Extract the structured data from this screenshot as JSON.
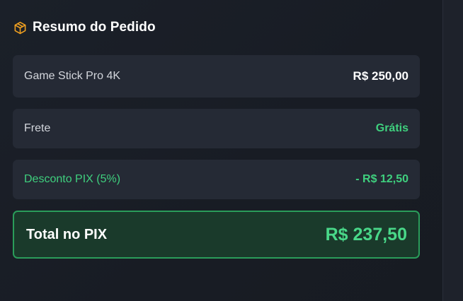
{
  "summary": {
    "title": "Resumo do Pedido",
    "icon": "package-icon",
    "accent_color": "#f0a020"
  },
  "items": {
    "product": {
      "label": "Game Stick Pro 4K",
      "value": "R$ 250,00"
    },
    "shipping": {
      "label": "Frete",
      "value": "Grátis"
    },
    "discount": {
      "label": "Desconto PIX (5%)",
      "value": "- R$ 12,50"
    }
  },
  "total": {
    "label": "Total no PIX",
    "value": "R$ 237,50"
  },
  "colors": {
    "success": "#3fd07e",
    "total_border": "#2a9c5a",
    "total_bg": "#1a3a2b"
  }
}
